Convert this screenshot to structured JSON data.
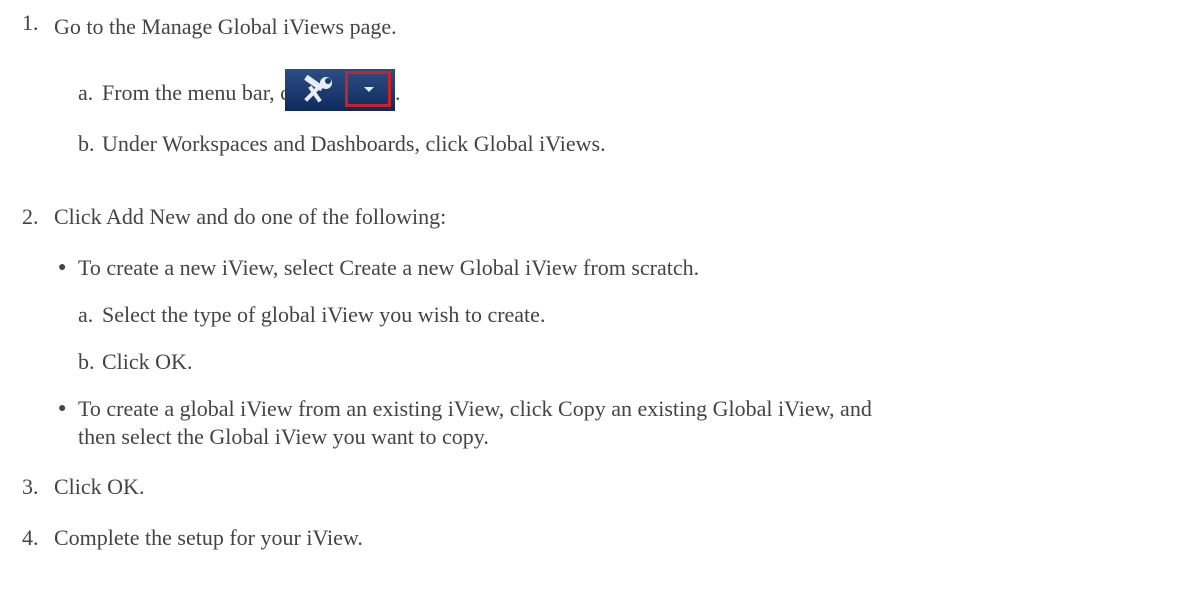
{
  "steps": [
    {
      "num": "1.",
      "text": "Go to the Manage Global iViews page.",
      "sub": [
        {
          "letter": "a.",
          "text": "From the menu bar, click",
          "trail": "."
        },
        {
          "letter": "b.",
          "text": "Under Workspaces and Dashboards, click Global iViews."
        }
      ]
    },
    {
      "num": "2.",
      "text": "Click Add New and do one of the following:",
      "bullets": [
        {
          "text": "To create a new iView, select Create a new Global iView from scratch.",
          "sub": [
            {
              "letter": "a.",
              "text": "Select the type of global iView you wish to create."
            },
            {
              "letter": "b.",
              "text": "Click OK."
            }
          ]
        },
        {
          "text": "To create a global iView from an existing iView, click Copy an existing Global iView, and",
          "cont": "then select the Global iView you want to copy."
        }
      ]
    },
    {
      "num": "3.",
      "text": "Click OK."
    },
    {
      "num": "4.",
      "text": "Complete the setup for your iView."
    }
  ],
  "icons": {
    "tools": "tools-icon",
    "dropdown": "chevron-down-icon"
  },
  "colors": {
    "text": "#444444",
    "toolbar": "#0d2a5c",
    "highlight": "#cc1f26"
  }
}
